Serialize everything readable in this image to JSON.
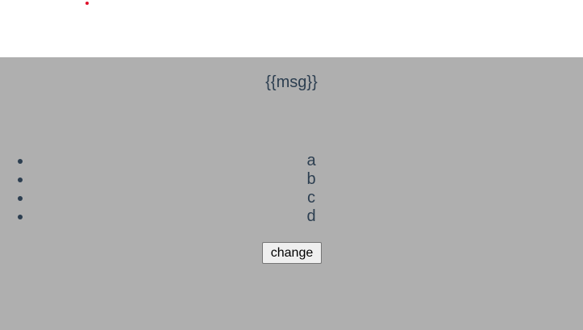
{
  "app": {
    "message": "{{msg}}",
    "items": [
      "a",
      "b",
      "c",
      "d"
    ],
    "change_button_label": "change"
  },
  "colors": {
    "background": "#afafaf",
    "text": "#2c3e50",
    "indicator": "#e0102a"
  }
}
